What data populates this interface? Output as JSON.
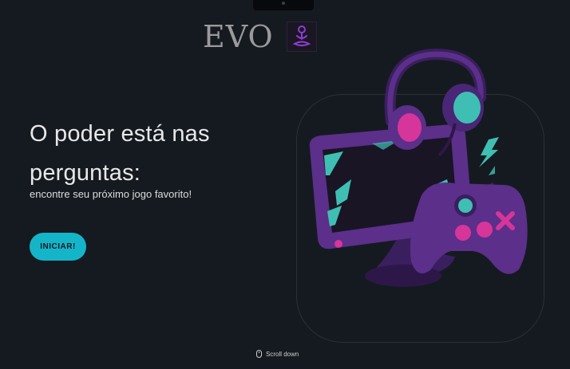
{
  "logo": {
    "text": "EVO",
    "icon": "meditation-figure-icon"
  },
  "hero": {
    "title": "O poder está nas perguntas:",
    "subtitle": "encontre seu próximo jogo favorito!",
    "cta_label": "INICIAR!",
    "illustration": "gaming-setup-illustration"
  },
  "footer": {
    "scroll_label": "Scroll down",
    "scroll_icon": "mouse-icon"
  },
  "colors": {
    "background": "#151a20",
    "accent_cyan": "#14b5c9",
    "accent_purple": "#5b2f8a",
    "accent_pink": "#d6359a",
    "accent_teal": "#3fbfb3"
  }
}
